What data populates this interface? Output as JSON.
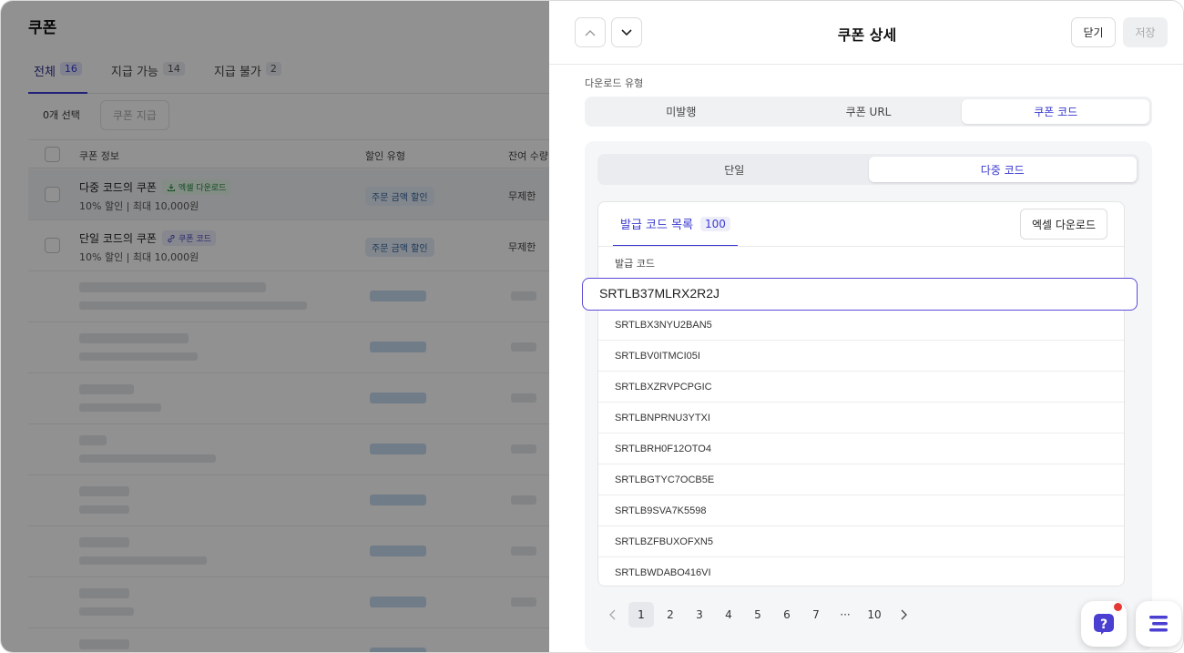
{
  "colors": {
    "accent": "#3a3ad1",
    "overlay": "rgba(0,0,0,0.43)",
    "focus_border": "#5b4bd6"
  },
  "list_page": {
    "title": "쿠폰",
    "tabs": [
      {
        "label": "전체",
        "count": "16"
      },
      {
        "label": "지급 가능",
        "count": "14"
      },
      {
        "label": "지급 불가",
        "count": "2"
      }
    ],
    "selected_count": "0개 선택",
    "issue_button": "쿠폰 지급",
    "columns": [
      "쿠폰 정보",
      "할인 유형",
      "잔여 수량"
    ],
    "rows": [
      {
        "title": "다중 코드의 쿠폰",
        "tag": "엑셀 다운로드",
        "tag_icon": "download-icon",
        "sub": "10% 할인 | 최대 10,000원",
        "type": "주문 금액 할인",
        "remaining": "무제한"
      },
      {
        "title": "단일 코드의 쿠폰",
        "tag": "쿠폰 코드",
        "tag_icon": "link-icon",
        "sub": "10% 할인 | 최대 10,000원",
        "type": "주문 금액 할인",
        "remaining": "무제한"
      }
    ]
  },
  "drawer": {
    "title": "쿠폰 상세",
    "close_label": "닫기",
    "save_label": "저장",
    "download_type_label": "다운로드 유형",
    "download_types": [
      "미발행",
      "쿠폰 URL",
      "쿠폰 코드"
    ],
    "download_type_selected": "쿠폰 코드",
    "code_modes": [
      "단일",
      "다중 코드"
    ],
    "code_mode_selected": "다중 코드",
    "list_tab_label": "발급 코드 목록",
    "list_tab_count": "100",
    "excel_button": "엑셀 다운로드",
    "column_header": "발급 코드",
    "focused_code": "SRTLB37MLRX2R2J",
    "codes": [
      "SRTLBX3NYU2BAN5",
      "SRTLBV0ITMCI05I",
      "SRTLBXZRVPCPGIC",
      "SRTLBNPRNU3YTXI",
      "SRTLBRH0F12OTO4",
      "SRTLBGTYC7OCB5E",
      "SRTLB9SVA7K5598",
      "SRTLBZFBUXOFXN5",
      "SRTLBWDABO416VI"
    ],
    "pagination": {
      "pages": [
        "1",
        "2",
        "3",
        "4",
        "5",
        "6",
        "7",
        "···",
        "10"
      ],
      "current": "1"
    }
  },
  "floating": {
    "help_icon": "question-icon",
    "menu_icon": "menu-icon"
  }
}
